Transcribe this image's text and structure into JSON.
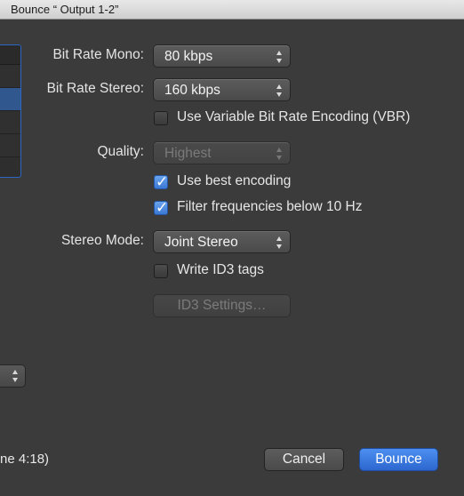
{
  "window": {
    "title": "Bounce “ Output 1-2”"
  },
  "form": {
    "bit_rate_mono": {
      "label": "Bit Rate Mono:",
      "value": "80 kbps"
    },
    "bit_rate_stereo": {
      "label": "Bit Rate Stereo:",
      "value": "160 kbps"
    },
    "vbr": {
      "label": "Use Variable Bit Rate Encoding (VBR)",
      "checked": false
    },
    "quality": {
      "label": "Quality:",
      "value": "Highest",
      "enabled": false
    },
    "best_encoding": {
      "label": "Use best encoding",
      "checked": true
    },
    "filter_freq": {
      "label": "Filter frequencies below 10 Hz",
      "checked": true
    },
    "stereo_mode": {
      "label": "Stereo Mode:",
      "value": "Joint Stereo"
    },
    "write_id3": {
      "label": "Write ID3 tags",
      "checked": false
    },
    "id3_settings": {
      "label": "ID3 Settings…",
      "enabled": false
    }
  },
  "footer": {
    "duration_text": "ne 4:18)",
    "cancel_label": "Cancel",
    "bounce_label": "Bounce"
  },
  "colors": {
    "background": "#3b3b3b",
    "accent": "#3a78d4",
    "selection": "#30588f"
  }
}
